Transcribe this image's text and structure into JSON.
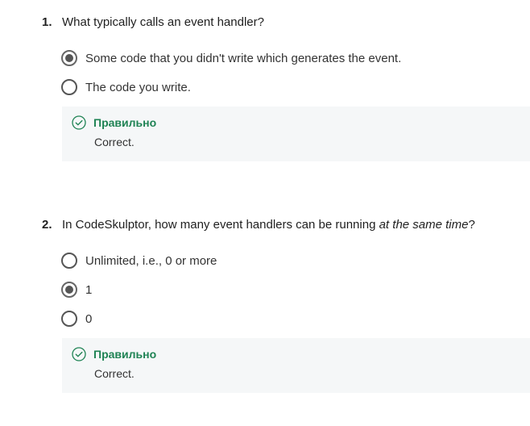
{
  "questions": [
    {
      "number": "1.",
      "text_before": "What typically calls an event handler?",
      "text_italic": "",
      "text_after": "",
      "options": [
        {
          "label": "Some code that you didn't write which generates the event.",
          "selected": true
        },
        {
          "label": "The code you write.",
          "selected": false
        }
      ],
      "feedback": {
        "status": "Правильно",
        "message": "Correct."
      }
    },
    {
      "number": "2.",
      "text_before": "In CodeSkulptor, how many event handlers can be running ",
      "text_italic": "at the same time",
      "text_after": "?",
      "options": [
        {
          "label": "Unlimited, i.e., 0 or more",
          "selected": false
        },
        {
          "label": "1",
          "selected": true
        },
        {
          "label": "0",
          "selected": false
        }
      ],
      "feedback": {
        "status": "Правильно",
        "message": "Correct."
      }
    }
  ],
  "colors": {
    "correct_green": "#1f8354",
    "feedback_bg": "#f5f7f8",
    "radio_border": "#555555"
  }
}
